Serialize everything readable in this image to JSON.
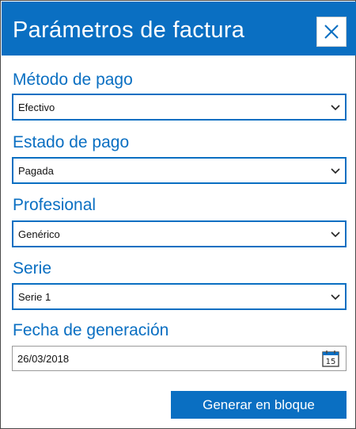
{
  "dialog": {
    "title": "Parámetros de factura",
    "close_icon": "close-icon"
  },
  "fields": {
    "payment_method": {
      "label": "Método de pago",
      "value": "Efectivo"
    },
    "payment_status": {
      "label": "Estado de pago",
      "value": "Pagada"
    },
    "professional": {
      "label": "Profesional",
      "value": "Genérico"
    },
    "series": {
      "label": "Serie",
      "value": "Serie 1"
    },
    "generation_date": {
      "label": "Fecha de generación",
      "value": "26/03/2018",
      "calendar_day": "15"
    }
  },
  "actions": {
    "generate_label": "Generar en bloque"
  },
  "colors": {
    "accent": "#0a6fc2"
  }
}
